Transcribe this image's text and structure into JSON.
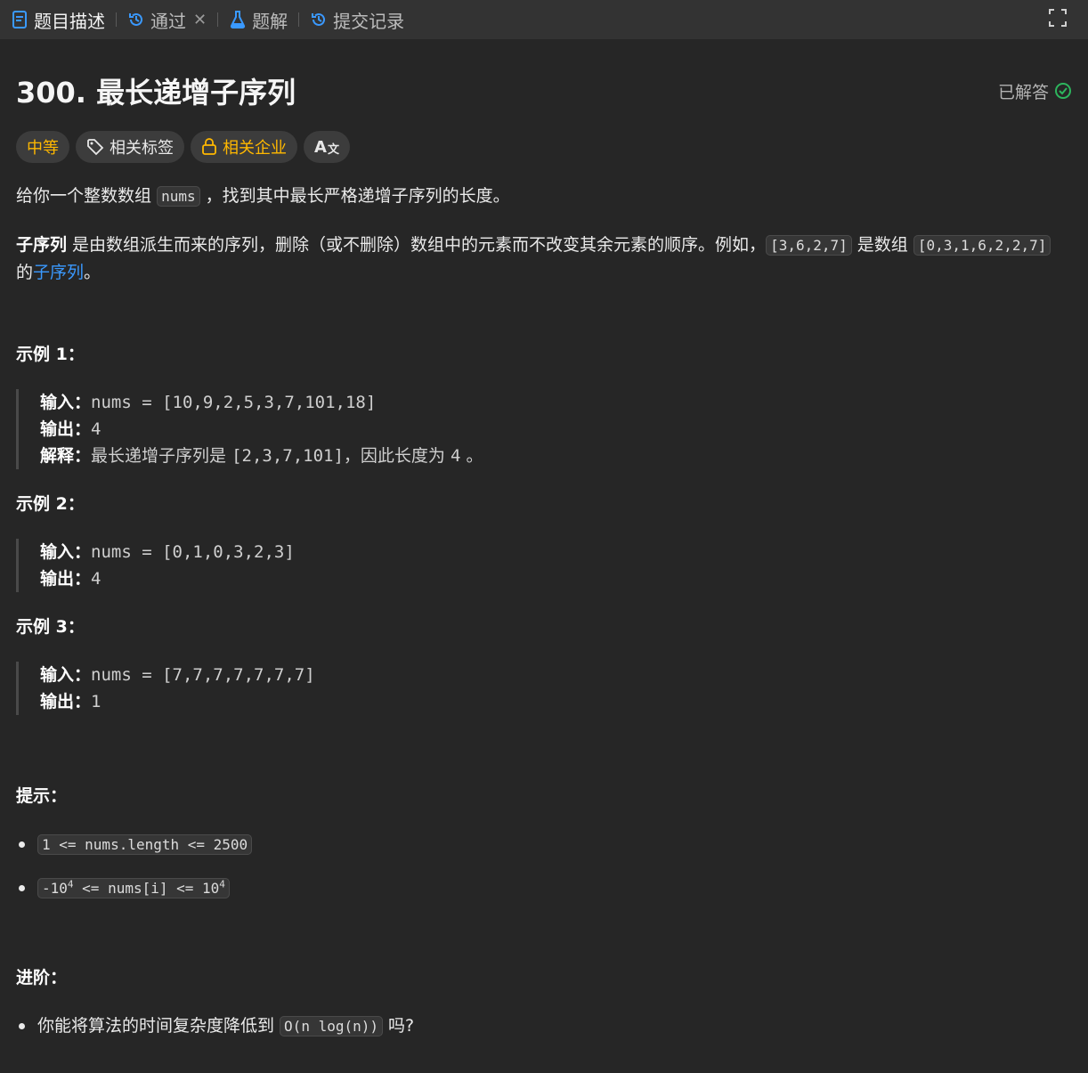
{
  "tabs": [
    {
      "label": "题目描述",
      "icon": "document-icon"
    },
    {
      "label": "通过",
      "icon": "history-icon"
    },
    {
      "label": "题解",
      "icon": "flask-icon"
    },
    {
      "label": "提交记录",
      "icon": "history-icon"
    }
  ],
  "problem": {
    "title": "300. 最长递增子序列",
    "status": "已解答",
    "difficulty": "中等",
    "tags_label": "相关标签",
    "company_label": "相关企业",
    "translate_label": "A"
  },
  "description": {
    "p1_a": "给你一个整数数组",
    "p1_code": "nums",
    "p1_b": "，找到其中最长严格递增子序列的长度。",
    "p2_bold": "子序列",
    "p2_a": " 是由数组派生而来的序列，删除（或不删除）数组中的元素而不改变其余元素的顺序。例如，",
    "p2_code1": "[3,6,2,7]",
    "p2_b": " 是数组 ",
    "p2_code2": "[0,3,1,6,2,2,7]",
    "p2_c": " 的",
    "p2_link": "子序列",
    "p2_d": "。"
  },
  "examples": [
    {
      "title": "示例 1：",
      "input_label": "输入：",
      "input": "nums = [10,9,2,5,3,7,101,18]",
      "output_label": "输出：",
      "output": "4",
      "explain_label": "解释：",
      "explain_a": "最长递增子序列是 ",
      "explain_code": "[2,3,7,101]",
      "explain_b": "，因此长度为 ",
      "explain_num": "4",
      "explain_c": " 。"
    },
    {
      "title": "示例 2：",
      "input_label": "输入：",
      "input": "nums = [0,1,0,3,2,3]",
      "output_label": "输出：",
      "output": "4"
    },
    {
      "title": "示例 3：",
      "input_label": "输入：",
      "input": "nums = [7,7,7,7,7,7,7]",
      "output_label": "输出：",
      "output": "1"
    }
  ],
  "hints": {
    "title": "提示：",
    "c1": "1 <= nums.length <= 2500",
    "c2_a": "-10",
    "c2_sup1": "4",
    "c2_b": " <= nums[i] <= 10",
    "c2_sup2": "4"
  },
  "followup": {
    "title": "进阶：",
    "text_a": "你能将算法的时间复杂度降低到 ",
    "code": "O(n log(n))",
    "text_b": " 吗?"
  },
  "colors": {
    "accent_blue": "#3a99ff",
    "difficulty": "#ffb800",
    "solved_check": "#2db55d"
  }
}
